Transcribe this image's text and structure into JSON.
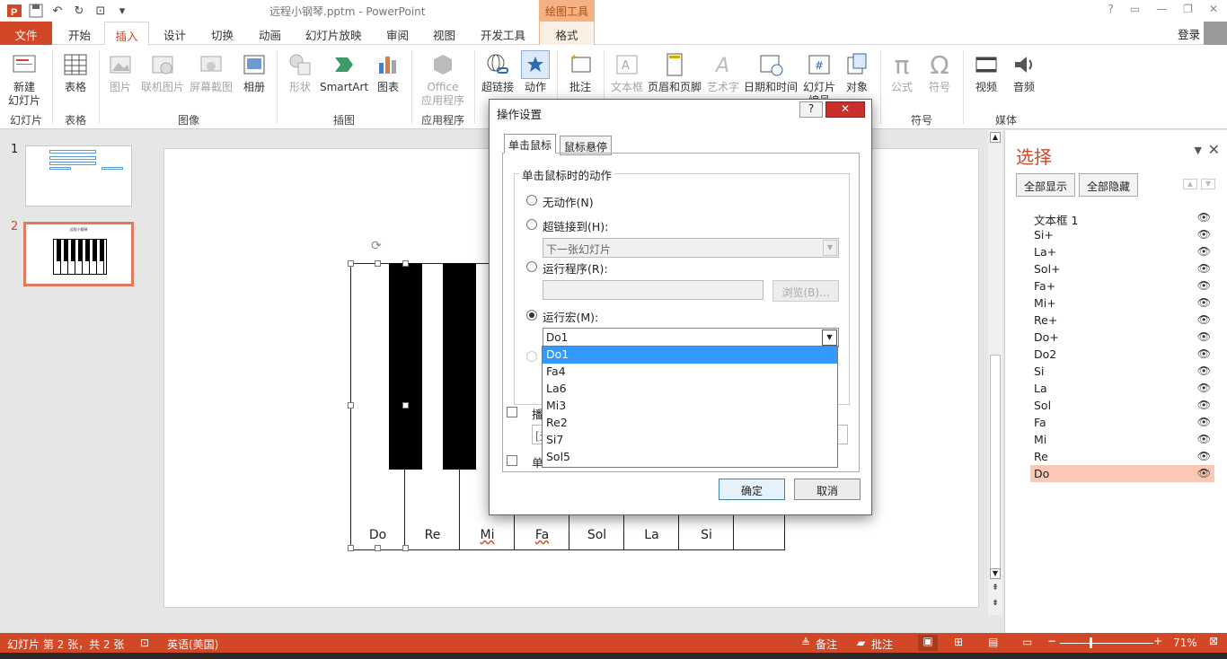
{
  "title_bar": {
    "doc_title": "远程小钢琴.pptm - PowerPoint",
    "context_group": "绘图工具",
    "window_controls": [
      "?",
      "▭",
      "—",
      "❐",
      "✕"
    ]
  },
  "tabs": [
    "文件",
    "开始",
    "插入",
    "设计",
    "切换",
    "动画",
    "幻灯片放映",
    "审阅",
    "视图",
    "开发工具",
    "格式"
  ],
  "login": "登录",
  "ribbon": {
    "buttons": [
      "新建\n幻灯片",
      "表格",
      "图片",
      "联机图片",
      "屏幕截图",
      "相册",
      "形状",
      "SmartArt",
      "图表",
      "Office\n应用程序",
      "超链接",
      "动作",
      "批注",
      "文本框",
      "页眉和页脚",
      "艺术字",
      "日期和时间",
      "幻灯片\n编号",
      "对象",
      "公式",
      "符号",
      "视频",
      "音频"
    ],
    "groups": [
      "幻灯片",
      "表格",
      "图像",
      "插图",
      "应用程序",
      "符号",
      "媒体"
    ]
  },
  "slides_pane": {
    "numbers": [
      "1",
      "2"
    ]
  },
  "slide": {
    "keys": [
      "Do",
      "Re",
      "Mi",
      "Fa",
      "Sol",
      "La",
      "Si"
    ],
    "thumb2_title": "远程小钢琴"
  },
  "dialog": {
    "title": "操作设置",
    "help": "?",
    "close": "✕",
    "tab_click": "单击鼠标",
    "tab_hover": "鼠标悬停",
    "group_label": "单击鼠标时的动作",
    "opt_none": "无动作(N)",
    "opt_hyperlink": "超链接到(H):",
    "hyperlink_value": "下一张幻灯片",
    "opt_program": "运行程序(R):",
    "browse": "浏览(B)...",
    "opt_macro": "运行宏(M):",
    "macro_value": "Do1",
    "macro_options": [
      "Do1",
      "Fa4",
      "La6",
      "Mi3",
      "Re2",
      "Si7",
      "Sol5"
    ],
    "play_sound_partial": "播",
    "sound_partial": "[无",
    "highlight_partial": "单",
    "ok": "确定",
    "cancel": "取消"
  },
  "selection_pane": {
    "title": "选择",
    "show_all": "全部显示",
    "hide_all": "全部隐藏",
    "items": [
      "文本框 1",
      "Si+",
      "La+",
      "Sol+",
      "Fa+",
      "Mi+",
      "Re+",
      "Do+",
      "Do2",
      "Si",
      "La",
      "Sol",
      "Fa",
      "Mi",
      "Re",
      "Do"
    ],
    "active_item": "Do"
  },
  "status_bar": {
    "slide_info": "幻灯片 第 2 张，共 2 张",
    "language": "英语(美国)",
    "notes": "备注",
    "comments": "批注",
    "zoom": "71%"
  },
  "colors": {
    "accent": "#d24726",
    "highlight": "#3399ff"
  }
}
